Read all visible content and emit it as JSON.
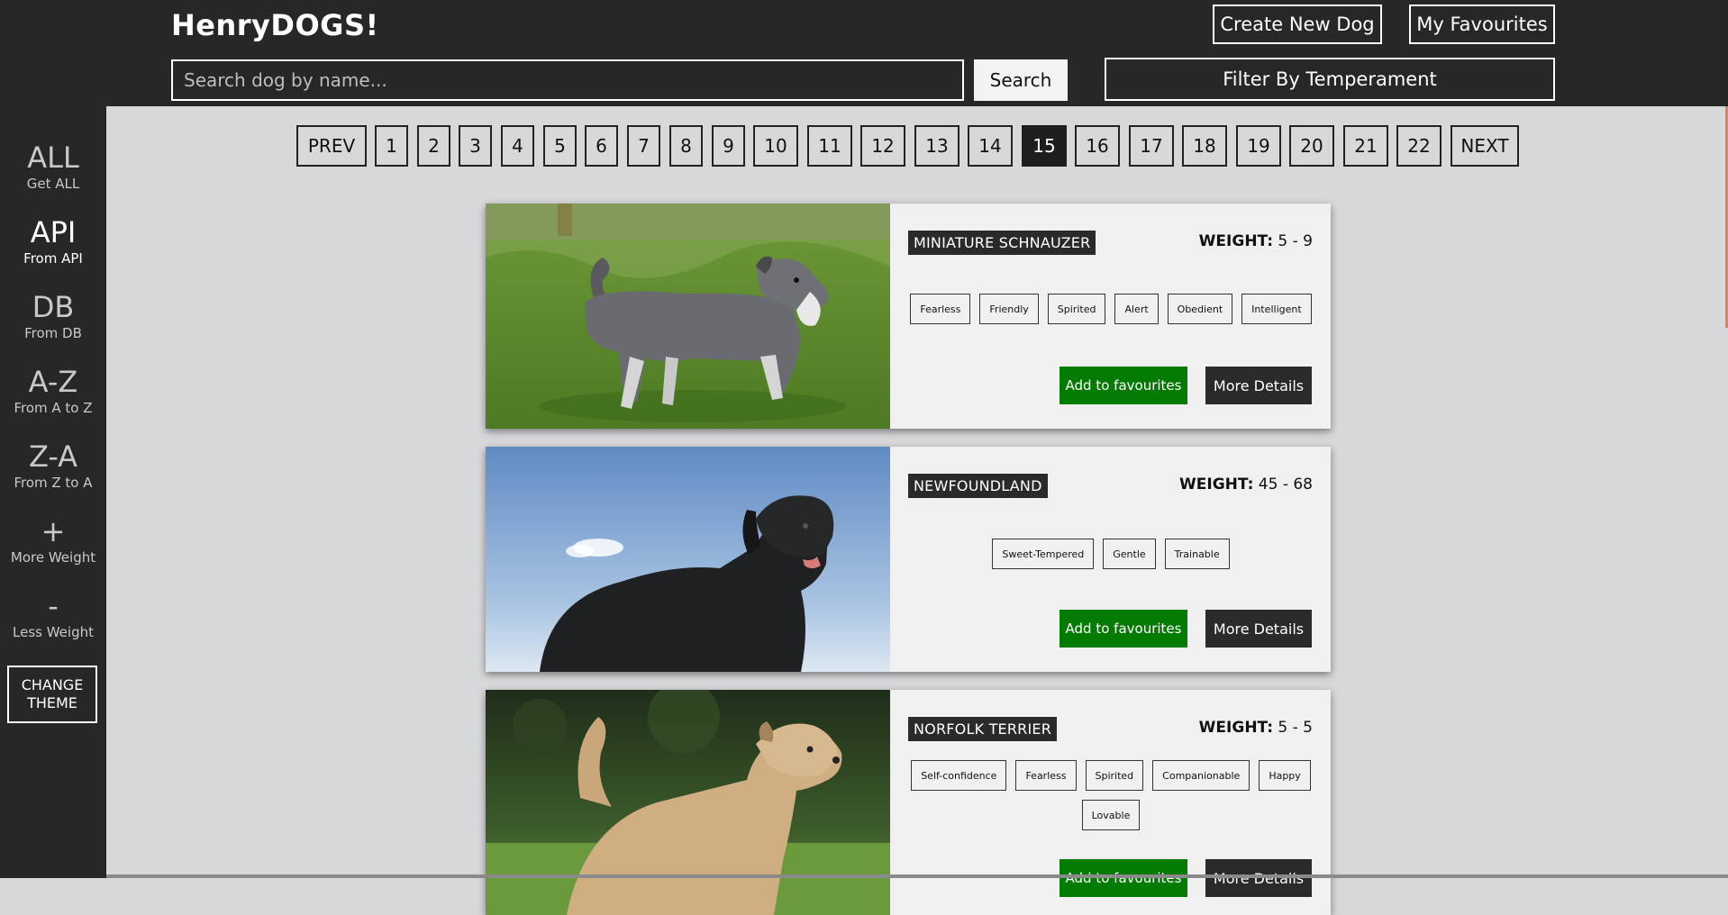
{
  "header": {
    "brand": "HenryDOGS!",
    "create_label": "Create New Dog",
    "favourites_label": "My Favourites",
    "search_placeholder": "Search dog by name...",
    "search_label": "Search",
    "filter_label": "Filter By Temperament"
  },
  "sidebar": {
    "items": [
      {
        "big": "ALL",
        "small": "Get ALL"
      },
      {
        "big": "API",
        "small": "From API"
      },
      {
        "big": "DB",
        "small": "From DB"
      },
      {
        "big": "A-Z",
        "small": "From A to Z"
      },
      {
        "big": "Z-A",
        "small": "From Z to A"
      },
      {
        "big": "+",
        "small": "More Weight"
      },
      {
        "big": "-",
        "small": "Less Weight"
      }
    ],
    "theme_label_1": "CHANGE",
    "theme_label_2": "THEME"
  },
  "pagination": {
    "prev": "PREV",
    "next": "NEXT",
    "pages": [
      "1",
      "2",
      "3",
      "4",
      "5",
      "6",
      "7",
      "8",
      "9",
      "10",
      "11",
      "12",
      "13",
      "14",
      "15",
      "16",
      "17",
      "18",
      "19",
      "20",
      "21",
      "22"
    ],
    "current": "15"
  },
  "cards": [
    {
      "name": "MINIATURE SCHNAUZER",
      "weight_label": "WEIGHT:",
      "weight": "5 - 9",
      "temperaments": [
        "Fearless",
        "Friendly",
        "Spirited",
        "Alert",
        "Obedient",
        "Intelligent"
      ],
      "fav_label": "Add to favourites",
      "details_label": "More Details"
    },
    {
      "name": "NEWFOUNDLAND",
      "weight_label": "WEIGHT:",
      "weight": "45 - 68",
      "temperaments": [
        "Sweet-Tempered",
        "Gentle",
        "Trainable"
      ],
      "fav_label": "Add to favourites",
      "details_label": "More Details"
    },
    {
      "name": "NORFOLK TERRIER",
      "weight_label": "WEIGHT:",
      "weight": "5 - 5",
      "temperaments": [
        "Self-confidence",
        "Fearless",
        "Spirited",
        "Companionable",
        "Happy",
        "Lovable"
      ],
      "fav_label": "Add to favourites",
      "details_label": "More Details"
    }
  ],
  "colors": {
    "header_bg": "#272727",
    "page_bg": "#d7d8da",
    "fav_green": "#047c04",
    "card_bg": "#f0f0f0"
  }
}
